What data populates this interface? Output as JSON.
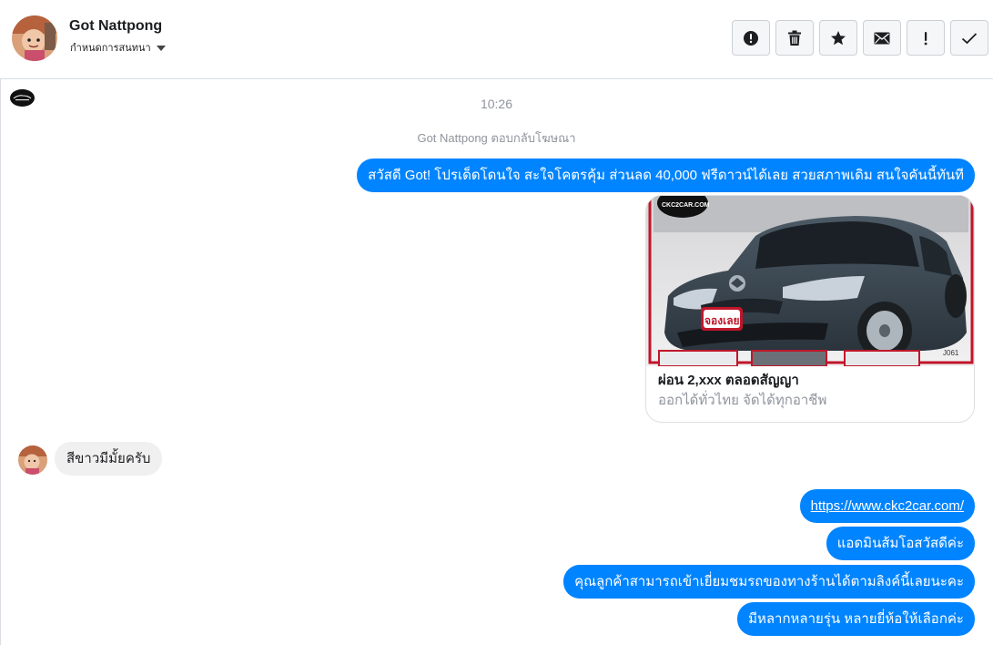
{
  "header": {
    "contact_name": "Got Nattpong",
    "subtitle": "กำหนดการสนทนา",
    "actions": [
      {
        "name": "report-button",
        "icon": "alert-circle-icon"
      },
      {
        "name": "delete-button",
        "icon": "trash-icon"
      },
      {
        "name": "star-button",
        "icon": "star-icon"
      },
      {
        "name": "mark-unread-button",
        "icon": "envelope-icon"
      },
      {
        "name": "important-button",
        "icon": "exclamation-icon"
      },
      {
        "name": "done-button",
        "icon": "checkmark-icon"
      }
    ]
  },
  "conversation": {
    "timestamp": "10:26",
    "reply_note": "Got Nattpong ตอบกลับโฆษณา",
    "ad_message": "สวัสดี Got! โปรเด็ดโดนใจ สะใจโคตรคุ้ม ส่วนลด 40,000 ฟรีดาวน์ได้เลย สวยสภาพเดิม สนใจคันนี้ทันที",
    "ad_card": {
      "badge": "CKC2CAR.COM",
      "stamp": "จองเลย",
      "code": "J061",
      "title": "ผ่อน 2,xxx ตลอดสัญญา",
      "subtitle": "ออกได้ทั่วไทย จัดได้ทุกอาชีพ"
    },
    "incoming_message": "สีขาวมีมั้ยครับ",
    "replies": {
      "link": "https://www.ckc2car.com/",
      "greeting": "แอดมินส้มโอสวัสดีค่ะ",
      "visit": "คุณลูกค้าสามารถเข้าเยี่ยมชมรถของทางร้านได้ตามลิงค์นี้เลยนะคะ",
      "variety": "มีหลากหลายรุ่น หลายยี่ห้อให้เลือกค่ะ"
    }
  },
  "colors": {
    "outgoing_bubble": "#0084ff",
    "incoming_bubble": "#f1f0f0",
    "muted_text": "#90949c"
  }
}
